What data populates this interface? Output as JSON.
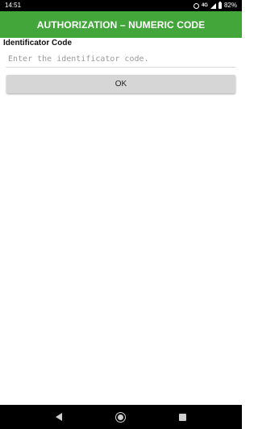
{
  "status_bar": {
    "time": "14:51",
    "network": "4G",
    "battery": "82%",
    "icons": [
      "alarm-icon",
      "signal-icon",
      "battery-icon"
    ]
  },
  "header": {
    "title": "AUTHORIZATION – NUMERIC CODE",
    "background_color": "#43a63a"
  },
  "form": {
    "label": "Identificator Code",
    "input_value": "",
    "input_placeholder": "Enter the identificator code.",
    "ok_label": "OK"
  },
  "nav_bar": {
    "icons": [
      "back-icon",
      "home-icon",
      "recents-icon"
    ]
  }
}
